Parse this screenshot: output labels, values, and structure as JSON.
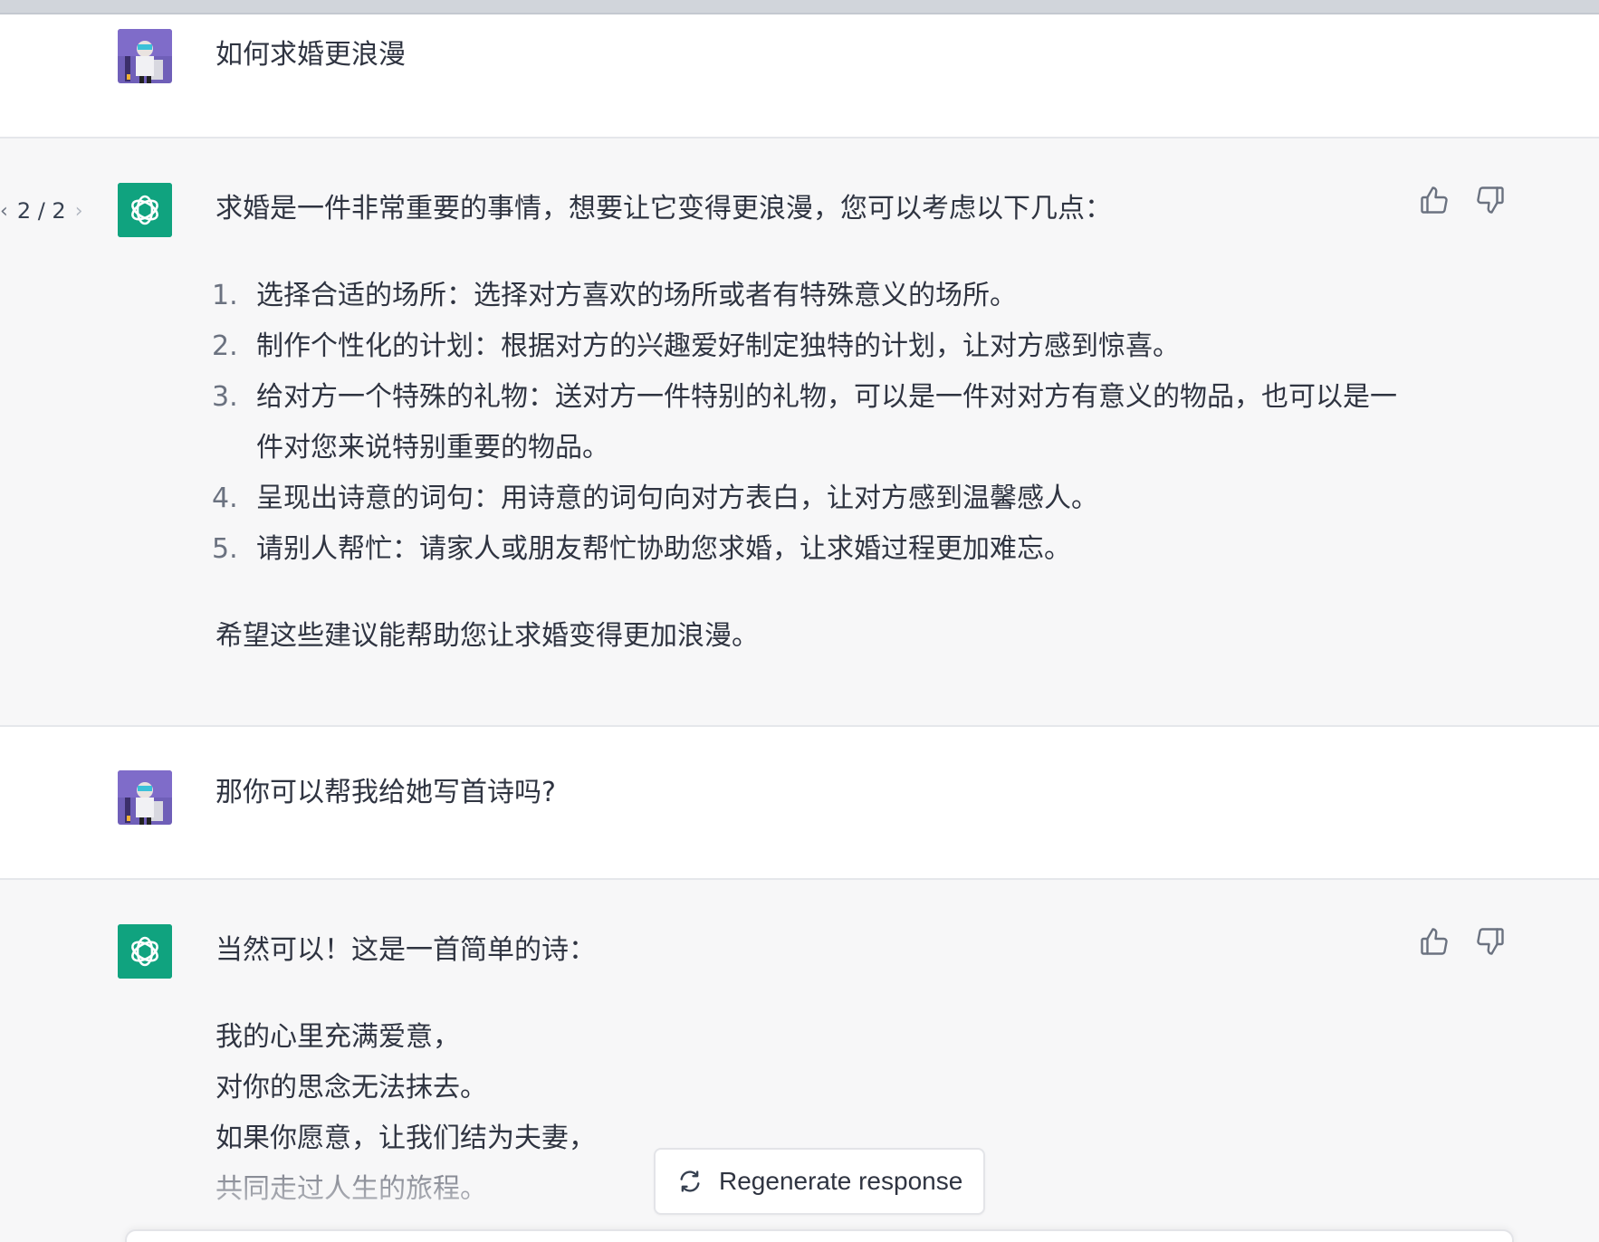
{
  "conversation": {
    "messages": [
      {
        "role": "user",
        "text": "如何求婚更浪漫"
      },
      {
        "role": "assistant",
        "pager": "2 / 2",
        "intro": "求婚是一件非常重要的事情，想要让它变得更浪漫，您可以考虑以下几点：",
        "list": [
          {
            "num": "1.",
            "text": "选择合适的场所：选择对方喜欢的场所或者有特殊意义的场所。"
          },
          {
            "num": "2.",
            "text": "制作个性化的计划：根据对方的兴趣爱好制定独特的计划，让对方感到惊喜。"
          },
          {
            "num": "3.",
            "text": "给对方一个特殊的礼物：送对方一件特别的礼物，可以是一件对对方有意义的物品，也可以是一件对您来说特别重要的物品。"
          },
          {
            "num": "4.",
            "text": "呈现出诗意的词句：用诗意的词句向对方表白，让对方感到温馨感人。"
          },
          {
            "num": "5.",
            "text": "请别人帮忙：请家人或朋友帮忙协助您求婚，让求婚过程更加难忘。"
          }
        ],
        "outro": "希望这些建议能帮助您让求婚变得更加浪漫。"
      },
      {
        "role": "user",
        "text": "那你可以帮我给她写首诗吗?"
      },
      {
        "role": "assistant",
        "intro": "当然可以！这是一首简单的诗：",
        "poem": [
          "我的心里充满爱意，",
          "对你的思念无法抹去。",
          "如果你愿意，让我们结为夫妻，",
          "共同走过人生的旅程。"
        ]
      }
    ]
  },
  "controls": {
    "regenerate_label": "Regenerate response"
  },
  "icons": {
    "user_avatar": "user-avatar-photo",
    "assistant_avatar": "openai-logo-icon",
    "thumbs_up": "thumbs-up-icon",
    "thumbs_down": "thumbs-down-icon",
    "pager_prev": "chevron-left-icon",
    "pager_next": "chevron-right-icon",
    "regenerate": "refresh-icon"
  },
  "colors": {
    "assistant_bg": "#f7f7f8",
    "brand_green": "#10a37f",
    "text": "#2f3441"
  }
}
